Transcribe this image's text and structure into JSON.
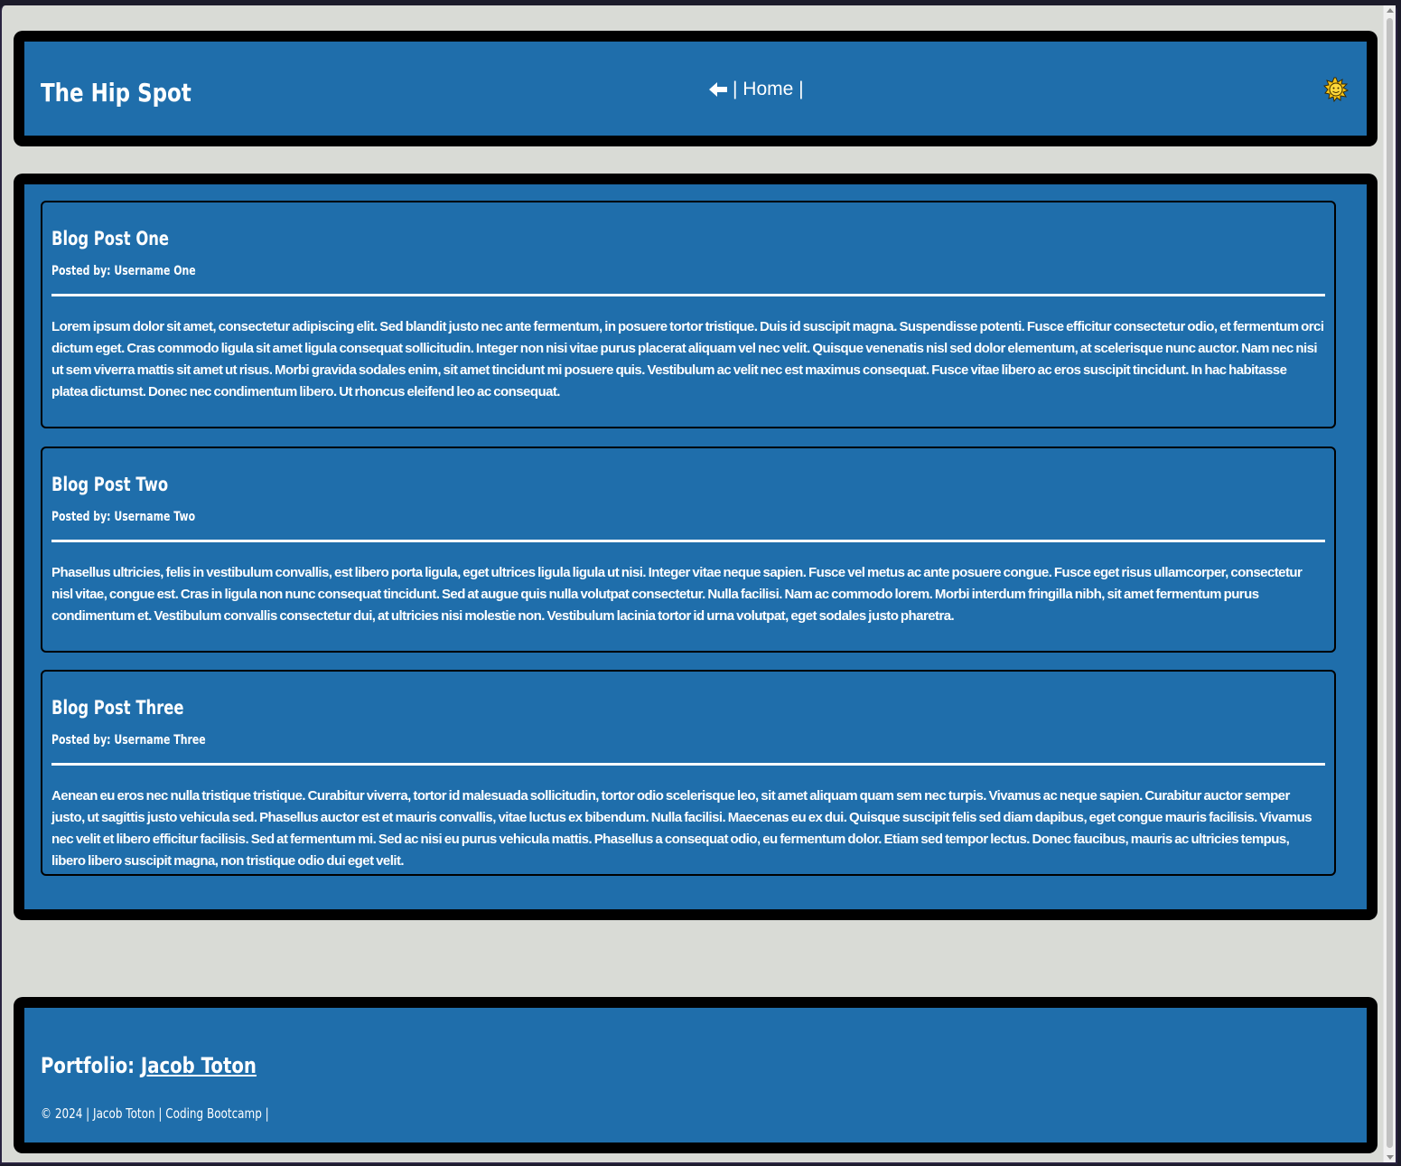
{
  "header": {
    "site_title": "The Hip Spot",
    "nav_text": "| Home |",
    "back_icon": "arrow-left-icon",
    "theme_toggle_icon": "sun-icon"
  },
  "posts": [
    {
      "title": "Blog Post One",
      "author": "Posted by: Username One",
      "body": "Lorem ipsum dolor sit amet, consectetur adipiscing elit. Sed blandit justo nec ante fermentum, in posuere tortor tristique. Duis id suscipit magna. Suspendisse potenti. Fusce efficitur consectetur odio, et fermentum orci dictum eget. Cras commodo ligula sit amet ligula consequat sollicitudin. Integer non nisi vitae purus placerat aliquam vel nec velit. Quisque venenatis nisl sed dolor elementum, at scelerisque nunc auctor. Nam nec nisi ut sem viverra mattis sit amet ut risus. Morbi gravida sodales enim, sit amet tincidunt mi posuere quis. Vestibulum ac velit nec est maximus consequat. Fusce vitae libero ac eros suscipit tincidunt. In hac habitasse platea dictumst. Donec nec condimentum libero. Ut rhoncus eleifend leo ac consequat."
    },
    {
      "title": "Blog Post Two",
      "author": "Posted by: Username Two",
      "body": "Phasellus ultricies, felis in vestibulum convallis, est libero porta ligula, eget ultrices ligula ligula ut nisi. Integer vitae neque sapien. Fusce vel metus ac ante posuere congue. Fusce eget risus ullamcorper, consectetur nisl vitae, congue est. Cras in ligula non nunc consequat tincidunt. Sed at augue quis nulla volutpat consectetur. Nulla facilisi. Nam ac commodo lorem. Morbi interdum fringilla nibh, sit amet fermentum purus condimentum et. Vestibulum convallis consectetur dui, at ultricies nisi molestie non. Vestibulum lacinia tortor id urna volutpat, eget sodales justo pharetra."
    },
    {
      "title": "Blog Post Three",
      "author": "Posted by: Username Three",
      "body": "Aenean eu eros nec nulla tristique tristique. Curabitur viverra, tortor id malesuada sollicitudin, tortor odio scelerisque leo, sit amet aliquam quam sem nec turpis. Vivamus ac neque sapien. Curabitur auctor semper justo, ut sagittis justo vehicula sed. Phasellus auctor est et mauris convallis, vitae luctus ex bibendum. Nulla facilisi. Maecenas eu ex dui. Quisque suscipit felis sed diam dapibus, eget congue mauris facilisis. Vivamus nec velit et libero efficitur facilisis. Sed at fermentum mi. Sed ac nisi eu purus vehicula mattis. Phasellus a consequat odio, eu fermentum dolor. Etiam sed tempor lectus. Donec faucibus, mauris ac ultricies tempus, libero libero suscipit magna, non tristique odio dui eget velit."
    }
  ],
  "footer": {
    "portfolio_label": "Portfolio:",
    "portfolio_link": "Jacob Toton",
    "copyright": "© 2024 | Jacob Toton | Coding Bootcamp |"
  },
  "colors": {
    "page_background": "#d9dbd6",
    "panel_background": "#1f6eab",
    "panel_border": "#000000",
    "text": "#ffffff"
  }
}
